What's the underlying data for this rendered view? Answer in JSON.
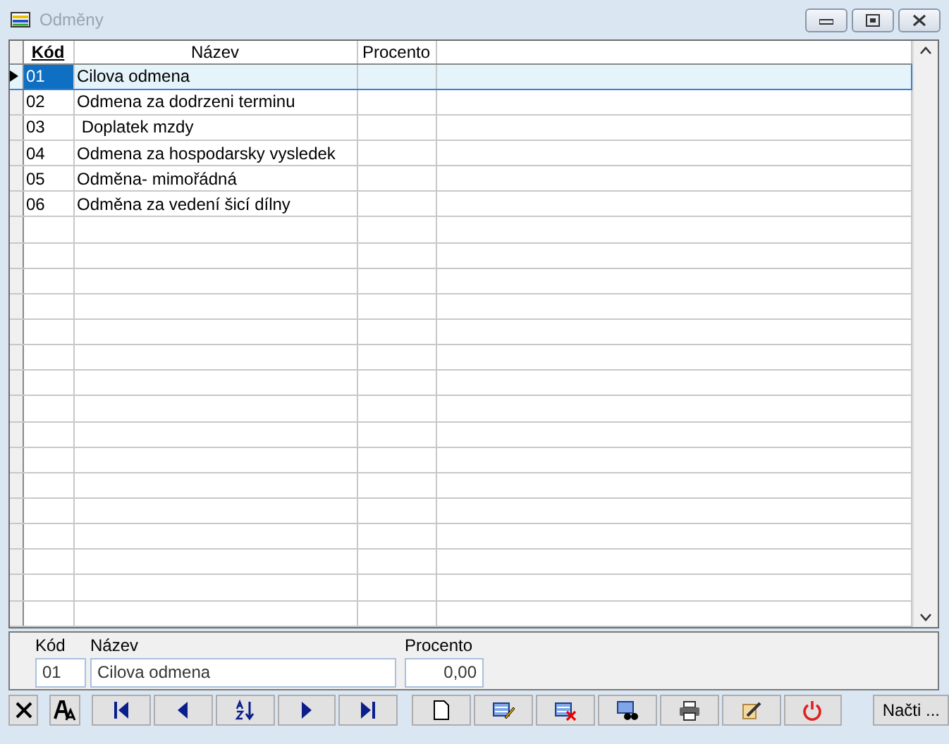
{
  "window": {
    "title": "Odměny"
  },
  "table": {
    "columns": [
      {
        "label": "Kód",
        "sorted": true
      },
      {
        "label": "Název",
        "sorted": false
      },
      {
        "label": "Procento",
        "sorted": false
      }
    ],
    "rows": [
      {
        "code": "01",
        "name": "Cilova odmena",
        "percent": "",
        "selected": true
      },
      {
        "code": "02",
        "name": "Odmena za dodrzeni terminu",
        "percent": "",
        "selected": false
      },
      {
        "code": "03",
        "name": " Doplatek mzdy",
        "percent": "",
        "selected": false
      },
      {
        "code": "04",
        "name": "Odmena za hospodarsky vysledek",
        "percent": "",
        "selected": false
      },
      {
        "code": "05",
        "name": "Odměna- mimořádná",
        "percent": "",
        "selected": false
      },
      {
        "code": "06",
        "name": "Odměna za vedení šicí dílny",
        "percent": "",
        "selected": false
      }
    ]
  },
  "form": {
    "fields": [
      {
        "label": "Kód",
        "value": "01"
      },
      {
        "label": "Název",
        "value": "Cilova odmena"
      },
      {
        "label": "Procento",
        "value": "0,00"
      }
    ]
  },
  "toolbar": [
    {
      "kind": "cancel"
    },
    {
      "kind": "font"
    },
    {
      "kind": "first"
    },
    {
      "kind": "prev"
    },
    {
      "kind": "sort"
    },
    {
      "kind": "next"
    },
    {
      "kind": "last"
    },
    {
      "kind": "new"
    },
    {
      "kind": "edit"
    },
    {
      "kind": "delete"
    },
    {
      "kind": "find"
    },
    {
      "kind": "print"
    },
    {
      "kind": "tools"
    },
    {
      "kind": "power"
    },
    {
      "kind": "text",
      "label": "Načti ..."
    }
  ]
}
